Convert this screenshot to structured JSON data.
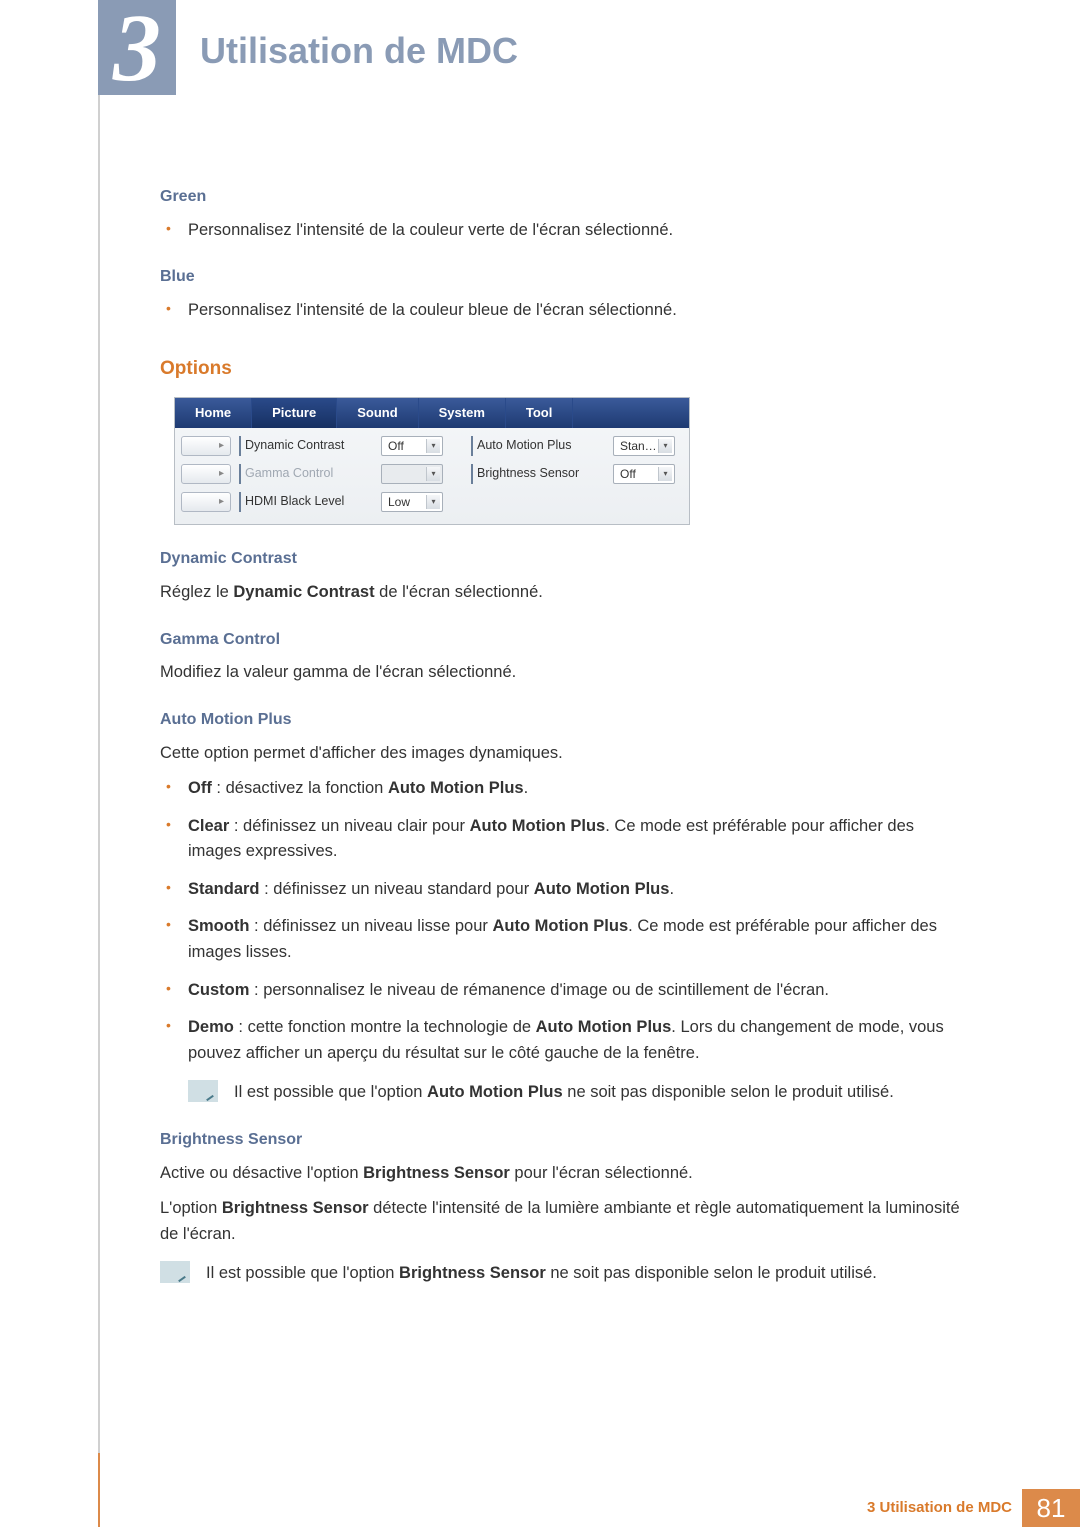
{
  "chapter": {
    "number": "3",
    "title": "Utilisation de MDC"
  },
  "sections": {
    "green": {
      "heading": "Green",
      "bullet1": "Personnalisez l'intensité de la couleur verte de l'écran sélectionné."
    },
    "blue": {
      "heading": "Blue",
      "bullet1": "Personnalisez l'intensité de la couleur bleue de l'écran sélectionné."
    },
    "options": {
      "heading": "Options"
    },
    "dynamic_contrast": {
      "heading": "Dynamic Contrast",
      "para_prefix": "Réglez le ",
      "para_bold": "Dynamic Contrast",
      "para_suffix": " de l'écran sélectionné."
    },
    "gamma_control": {
      "heading": "Gamma Control",
      "para": "Modifiez la valeur gamma de l'écran sélectionné."
    },
    "auto_motion_plus": {
      "heading": "Auto Motion Plus",
      "para": "Cette option permet d'afficher des images dynamiques.",
      "items": {
        "off": {
          "bold": "Off",
          "sep": " : ",
          "mid_pre": "désactivez la fonction ",
          "mid_bold": "Auto Motion Plus",
          "mid_post": "."
        },
        "clear": {
          "bold": "Clear",
          "sep": " : ",
          "mid_pre": "définissez un niveau clair pour ",
          "mid_bold": "Auto Motion Plus",
          "mid_post": ". Ce mode est préférable pour afficher des images expressives."
        },
        "standard": {
          "bold": "Standard",
          "sep": " : ",
          "mid_pre": "définissez un niveau standard pour ",
          "mid_bold": "Auto Motion Plus",
          "mid_post": "."
        },
        "smooth": {
          "bold": "Smooth",
          "sep": " : ",
          "mid_pre": "définissez un niveau lisse pour ",
          "mid_bold": "Auto Motion Plus",
          "mid_post": ". Ce mode est préférable pour afficher des images lisses."
        },
        "custom": {
          "bold": "Custom",
          "sep": " : ",
          "mid_pre": "personnalisez le niveau de rémanence d'image ou de scintillement de l'écran.",
          "mid_bold": "",
          "mid_post": ""
        },
        "demo": {
          "bold": "Demo",
          "sep": " : ",
          "mid_pre": "cette fonction montre la technologie de ",
          "mid_bold": "Auto Motion Plus",
          "mid_post": ". Lors du changement de mode, vous pouvez afficher un aperçu du résultat sur le côté gauche de la fenêtre."
        }
      },
      "note_pre": "Il est possible que l'option ",
      "note_bold": "Auto Motion Plus",
      "note_post": " ne soit pas disponible selon le produit utilisé."
    },
    "brightness_sensor": {
      "heading": "Brightness Sensor",
      "para1_pre": "Active ou désactive l'option ",
      "para1_bold": "Brightness Sensor",
      "para1_post": " pour l'écran sélectionné.",
      "para2_pre": "L'option ",
      "para2_bold": "Brightness Sensor",
      "para2_post": " détecte l'intensité de la lumière ambiante et règle automatiquement la luminosité de l'écran.",
      "note_pre": "Il est possible que l'option ",
      "note_bold": "Brightness Sensor",
      "note_post": " ne soit pas disponible selon le produit utilisé."
    }
  },
  "panel": {
    "tabs": {
      "home": "Home",
      "picture": "Picture",
      "sound": "Sound",
      "system": "System",
      "tool": "Tool"
    },
    "rows": {
      "dynamic_contrast": {
        "label": "Dynamic Contrast",
        "value": "Off"
      },
      "auto_motion_plus": {
        "label": "Auto Motion Plus",
        "value": "Stan…"
      },
      "gamma_control": {
        "label": "Gamma Control",
        "value": ""
      },
      "brightness_sensor": {
        "label": "Brightness Sensor",
        "value": "Off"
      },
      "hdmi_black_level": {
        "label": "HDMI Black Level",
        "value": "Low"
      }
    },
    "expand_glyph": "▸"
  },
  "footer": {
    "text": "3 Utilisation de MDC",
    "page": "81"
  }
}
